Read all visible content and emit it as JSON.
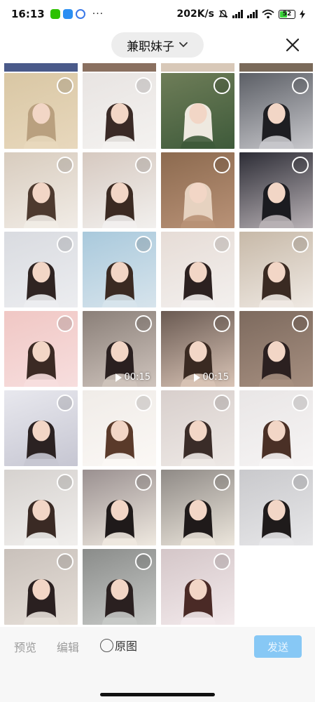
{
  "status_bar": {
    "time": "16:13",
    "more": "···",
    "net_speed": "202K/s",
    "battery_level": "52",
    "battery_fraction": 0.52,
    "icons": [
      "wechat-icon",
      "cloud-icon",
      "q-icon",
      "mute-icon",
      "signal-icon",
      "signal-icon",
      "wifi-icon",
      "battery-icon",
      "charging-icon"
    ]
  },
  "header": {
    "album_title": "兼职妹子",
    "dropdown_icon": "chevron-down-icon",
    "close_icon": "close-icon"
  },
  "grid": {
    "columns": 4,
    "photos": [
      {
        "type": "image",
        "palette": [
          "#d9c7a4",
          "#e8d8bd",
          "#b9a07f"
        ]
      },
      {
        "type": "image",
        "palette": [
          "#e8e4e2",
          "#f4f2f0",
          "#3a2a26"
        ]
      },
      {
        "type": "image",
        "palette": [
          "#6e7d58",
          "#3e5a3a",
          "#eee9e0"
        ]
      },
      {
        "type": "image",
        "palette": [
          "#5c5f66",
          "#c8c8cc",
          "#1e1e22"
        ]
      },
      {
        "type": "image",
        "palette": [
          "#d8ccbe",
          "#f1ece6",
          "#4d3a2f"
        ]
      },
      {
        "type": "image",
        "palette": [
          "#d6c9c0",
          "#f2f0ee",
          "#3b2a22"
        ]
      },
      {
        "type": "image",
        "palette": [
          "#8c6a4f",
          "#b99277",
          "#e6d2c0"
        ]
      },
      {
        "type": "image",
        "palette": [
          "#2d2d36",
          "#b9b2b6",
          "#1b1b20"
        ]
      },
      {
        "type": "image",
        "palette": [
          "#d9dbe0",
          "#ecedf0",
          "#2f2422"
        ]
      },
      {
        "type": "image",
        "palette": [
          "#a9c9dc",
          "#d7e4ec",
          "#3a2a22"
        ]
      },
      {
        "type": "image",
        "palette": [
          "#e6dcd6",
          "#f3f0ee",
          "#2c2120"
        ]
      },
      {
        "type": "image",
        "palette": [
          "#c7b9a8",
          "#efe9e3",
          "#3a2a22"
        ]
      },
      {
        "type": "image",
        "palette": [
          "#f0c7c4",
          "#f7dede",
          "#3b2a24"
        ]
      },
      {
        "type": "video",
        "duration": "00:15",
        "palette": [
          "#8a7f78",
          "#cfc4bd",
          "#2a2020"
        ]
      },
      {
        "type": "video",
        "duration": "00:15",
        "palette": [
          "#6a5a52",
          "#d9c4b6",
          "#3a2a22"
        ]
      },
      {
        "type": "image",
        "palette": [
          "#7d6a5e",
          "#a68f80",
          "#2b2020"
        ]
      },
      {
        "type": "image",
        "palette": [
          "#e8e8ee",
          "#c6c6d2",
          "#2b2222"
        ]
      },
      {
        "type": "image",
        "palette": [
          "#f0ece8",
          "#fbf8f5",
          "#5a3a2a"
        ]
      },
      {
        "type": "image",
        "palette": [
          "#d8cfcc",
          "#eee9e6",
          "#3a2c28"
        ]
      },
      {
        "type": "image",
        "palette": [
          "#e9e6e6",
          "#f6f4f4",
          "#4a3026"
        ]
      },
      {
        "type": "image",
        "palette": [
          "#d6d2cf",
          "#f1efed",
          "#3a2a24"
        ]
      },
      {
        "type": "image",
        "palette": [
          "#9a9090",
          "#efe9e0",
          "#1f1a1a"
        ]
      },
      {
        "type": "image",
        "palette": [
          "#8f8a86",
          "#ece6dc",
          "#1f1a1a"
        ]
      },
      {
        "type": "image",
        "palette": [
          "#c9c9cc",
          "#e7e7e9",
          "#1f1b1b"
        ]
      },
      {
        "type": "image",
        "palette": [
          "#c9c1bb",
          "#e6dfd8",
          "#2a2020"
        ]
      },
      {
        "type": "image",
        "palette": [
          "#8a8c8a",
          "#c8cac8",
          "#2a2020"
        ]
      },
      {
        "type": "image",
        "palette": [
          "#d4c6c8",
          "#f3eaec",
          "#4a2a26"
        ]
      }
    ]
  },
  "bottom_bar": {
    "preview_label": "预览",
    "edit_label": "编辑",
    "original_label": "原图",
    "send_label": "发送"
  },
  "colors": {
    "send_button_bg": "#87c8f5",
    "album_selector_bg": "#ededed",
    "bottom_bar_bg": "#f7f7f7"
  }
}
